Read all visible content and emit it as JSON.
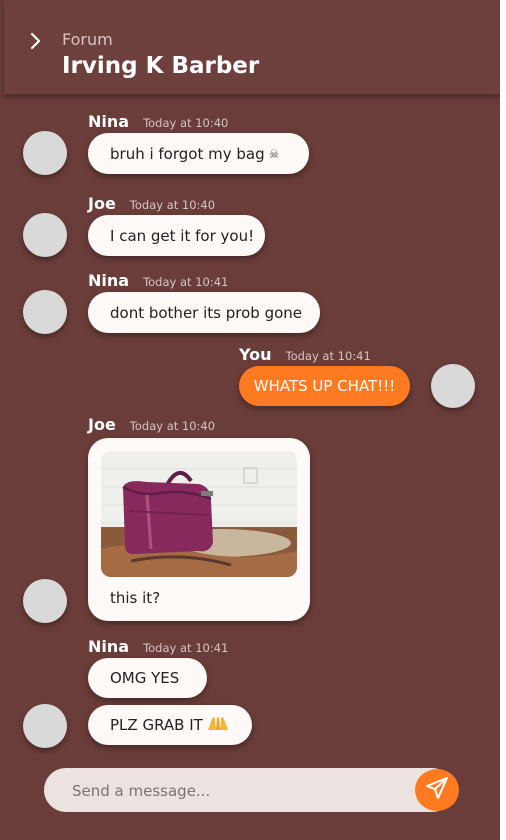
{
  "header": {
    "subtitle": "Forum",
    "title": "Irving K Barber"
  },
  "messages": [
    {
      "name": "Nina",
      "time": "Today at 10:40",
      "text": "bruh i forgot my bag",
      "emoji": "skull-icon"
    },
    {
      "name": "Joe",
      "time": "Today at 10:40",
      "text": "I can get it for you!"
    },
    {
      "name": "Nina",
      "time": "Today at 10:41",
      "text": "dont bother its prob gone"
    },
    {
      "name": "You",
      "time": "Today at 10:41",
      "text": "WHATS UP CHAT!!!"
    },
    {
      "name": "Joe",
      "time": "Today at 10:40",
      "text": "this it?",
      "image": "purple-bag-photo"
    },
    {
      "name": "Nina",
      "time": "Today at 10:41",
      "text": "OMG YES"
    },
    {
      "text": "PLZ GRAB IT",
      "emoji": "folded-hands-icon"
    }
  ],
  "composer": {
    "placeholder": "Send a message..."
  },
  "colors": {
    "background": "#6b3d3a",
    "header": "#6e403d",
    "accent": "#ff7a21",
    "bubble": "#fffaf7",
    "avatar": "#d9d9d9"
  },
  "icons": [
    "chevron-right-icon",
    "send-icon",
    "skull-icon",
    "folded-hands-icon"
  ]
}
